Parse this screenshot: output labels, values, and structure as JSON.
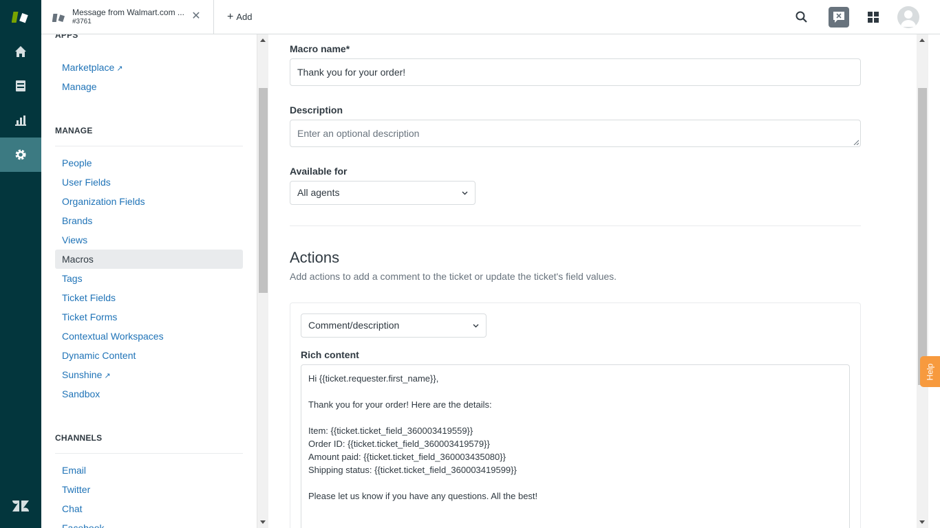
{
  "header": {
    "tab": {
      "title": "Message from Walmart.com ...",
      "subtitle": "#3761"
    },
    "add_label": "Add"
  },
  "sidebar": {
    "apps_section": "APPS",
    "apps_items": [
      {
        "label": "Marketplace",
        "external": true
      },
      {
        "label": "Manage",
        "external": false
      }
    ],
    "manage_section": "MANAGE",
    "manage_items": [
      {
        "label": "People"
      },
      {
        "label": "User Fields"
      },
      {
        "label": "Organization Fields"
      },
      {
        "label": "Brands"
      },
      {
        "label": "Views"
      },
      {
        "label": "Macros",
        "selected": true
      },
      {
        "label": "Tags"
      },
      {
        "label": "Ticket Fields"
      },
      {
        "label": "Ticket Forms"
      },
      {
        "label": "Contextual Workspaces"
      },
      {
        "label": "Dynamic Content"
      },
      {
        "label": "Sunshine",
        "external": true
      },
      {
        "label": "Sandbox"
      }
    ],
    "channels_section": "CHANNELS",
    "channels_items": [
      {
        "label": "Email"
      },
      {
        "label": "Twitter"
      },
      {
        "label": "Chat"
      },
      {
        "label": "Facebook"
      }
    ]
  },
  "form": {
    "macro_name_label": "Macro name*",
    "macro_name_value": "Thank you for your order!",
    "description_label": "Description",
    "description_placeholder": "Enter an optional description",
    "available_label": "Available for",
    "available_value": "All agents",
    "actions_title": "Actions",
    "actions_subtitle": "Add actions to add a comment to the ticket or update the ticket's field values.",
    "action_select_value": "Comment/description",
    "rich_content_label": "Rich content",
    "rich_content_lines": [
      "Hi {{ticket.requester.first_name}},",
      "",
      "Thank you for your order! Here are the details:",
      "",
      "Item: {{ticket.ticket_field_360003419559}}",
      "Order ID: {{ticket.ticket_field_360003419579}}",
      "Amount paid: {{ticket.ticket_field_360003435080}}",
      "Shipping status: {{ticket.ticket_field_360003419599}}",
      "",
      "Please let us know if you have any questions. All the best!"
    ]
  },
  "help_label": "Help",
  "colors": {
    "rail": "#03363d",
    "link": "#1f73b7",
    "help": "#f79a3e"
  }
}
